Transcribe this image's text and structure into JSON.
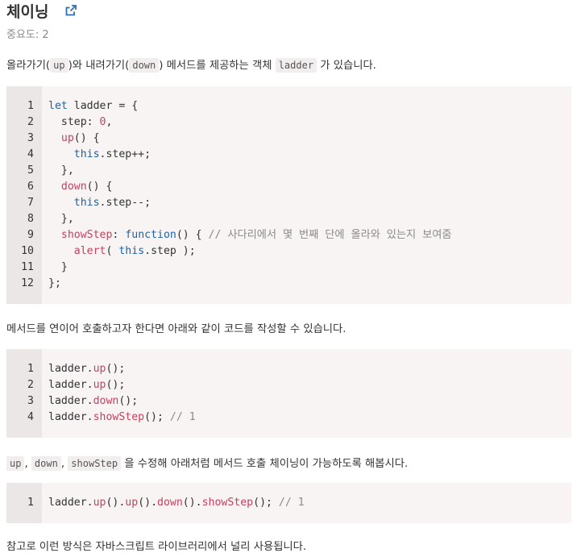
{
  "title": "체이닝",
  "share_icon": "external-link-icon",
  "importance": "중요도: 2",
  "intro": {
    "t1": "올라가기(",
    "c1": "up",
    "t2": ")와 내려가기(",
    "c2": "down",
    "t3": ") 메서드를 제공하는 객체 ",
    "c3": "ladder",
    "t4": " 가 있습니다."
  },
  "block1": [
    {
      "n": "1",
      "tokens": [
        {
          "t": "let",
          "c": "kw"
        },
        {
          "t": " ladder = {"
        }
      ]
    },
    {
      "n": "2",
      "tokens": [
        {
          "t": "  step: "
        },
        {
          "t": "0",
          "c": "num"
        },
        {
          "t": ","
        }
      ]
    },
    {
      "n": "3",
      "tokens": [
        {
          "t": "  "
        },
        {
          "t": "up",
          "c": "fn"
        },
        {
          "t": "() {"
        }
      ]
    },
    {
      "n": "4",
      "tokens": [
        {
          "t": "    "
        },
        {
          "t": "this",
          "c": "kw"
        },
        {
          "t": ".step++;"
        }
      ]
    },
    {
      "n": "5",
      "tokens": [
        {
          "t": "  },"
        }
      ]
    },
    {
      "n": "6",
      "tokens": [
        {
          "t": "  "
        },
        {
          "t": "down",
          "c": "fn"
        },
        {
          "t": "() {"
        }
      ]
    },
    {
      "n": "7",
      "tokens": [
        {
          "t": "    "
        },
        {
          "t": "this",
          "c": "kw"
        },
        {
          "t": ".step--;"
        }
      ]
    },
    {
      "n": "8",
      "tokens": [
        {
          "t": "  },"
        }
      ]
    },
    {
      "n": "9",
      "tokens": [
        {
          "t": "  "
        },
        {
          "t": "showStep",
          "c": "fn"
        },
        {
          "t": ": "
        },
        {
          "t": "function",
          "c": "kw"
        },
        {
          "t": "() { "
        },
        {
          "t": "// 사다리에서 몇 번째 단에 올라와 있는지 보여줌",
          "c": "cm"
        }
      ]
    },
    {
      "n": "10",
      "tokens": [
        {
          "t": "    "
        },
        {
          "t": "alert",
          "c": "fn"
        },
        {
          "t": "( "
        },
        {
          "t": "this",
          "c": "kw"
        },
        {
          "t": ".step );"
        }
      ]
    },
    {
      "n": "11",
      "tokens": [
        {
          "t": "  }"
        }
      ]
    },
    {
      "n": "12",
      "tokens": [
        {
          "t": "};"
        }
      ]
    }
  ],
  "para2": "메서드를 연이어 호출하고자 한다면 아래와 같이 코드를 작성할 수 있습니다.",
  "block2": [
    {
      "n": "1",
      "tokens": [
        {
          "t": "ladder."
        },
        {
          "t": "up",
          "c": "fn"
        },
        {
          "t": "();"
        }
      ]
    },
    {
      "n": "2",
      "tokens": [
        {
          "t": "ladder."
        },
        {
          "t": "up",
          "c": "fn"
        },
        {
          "t": "();"
        }
      ]
    },
    {
      "n": "3",
      "tokens": [
        {
          "t": "ladder."
        },
        {
          "t": "down",
          "c": "fn"
        },
        {
          "t": "();"
        }
      ]
    },
    {
      "n": "4",
      "tokens": [
        {
          "t": "ladder."
        },
        {
          "t": "showStep",
          "c": "fn"
        },
        {
          "t": "(); "
        },
        {
          "t": "// 1",
          "c": "cm"
        }
      ]
    }
  ],
  "para3": {
    "c1": "up",
    "s1": ", ",
    "c2": "down",
    "s2": ", ",
    "c3": "showStep",
    "t": " 을 수정해 아래처럼 메서드 호출 체이닝이 가능하도록 해봅시다."
  },
  "block3": [
    {
      "n": "1",
      "tokens": [
        {
          "t": "ladder."
        },
        {
          "t": "up",
          "c": "fn"
        },
        {
          "t": "()."
        },
        {
          "t": "up",
          "c": "fn"
        },
        {
          "t": "()."
        },
        {
          "t": "down",
          "c": "fn"
        },
        {
          "t": "()."
        },
        {
          "t": "showStep",
          "c": "fn"
        },
        {
          "t": "(); "
        },
        {
          "t": "// 1",
          "c": "cm"
        }
      ]
    }
  ],
  "para4": "참고로 이런 방식은 자바스크립트 라이브러리에서 널리 사용됩니다."
}
